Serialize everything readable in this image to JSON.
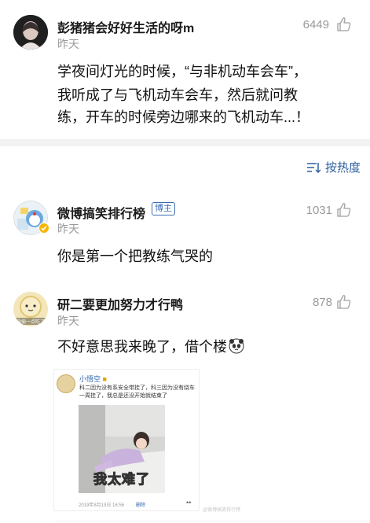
{
  "main_post": {
    "username": "彭猪猪会好好生活的呀m",
    "time": "昨天",
    "likes": "6449",
    "lines": [
      "学夜间灯光的时候，“与非机动车会车”，",
      "我听成了与飞机动车会车，然后就问教",
      "练，开车的时候旁边哪来的飞机动车...！"
    ]
  },
  "sort": {
    "label": "按热度",
    "icon": "sort-icon"
  },
  "comments": [
    {
      "username": "微博搞笑排行榜",
      "badge": "博主",
      "time": "昨天",
      "likes": "1031",
      "text": "你是第一个把教练气哭的"
    },
    {
      "username": "研二要更加努力才行鸭",
      "avatar_text": "偷偷一点吃了",
      "time": "昨天",
      "likes": "878",
      "text": "不好意思我来晚了，借个楼",
      "emoji": "panda-emoji",
      "image": {
        "name": "小悟空",
        "text": "科二因为没有系安全带挂了，科三因为没有绕车一周挂了，我总是还没开始就结束了",
        "caption": "我太难了",
        "date": "2019年8月19日 16:56",
        "delete": "删除",
        "dots": "••",
        "watermark": "@微博搞笑排行榜"
      }
    }
  ],
  "icons": {
    "like": "thumbs-up-icon"
  },
  "colors": {
    "link": "#2f5f9f",
    "muted": "#9a9a9a",
    "divider": "#f2f2f2"
  }
}
